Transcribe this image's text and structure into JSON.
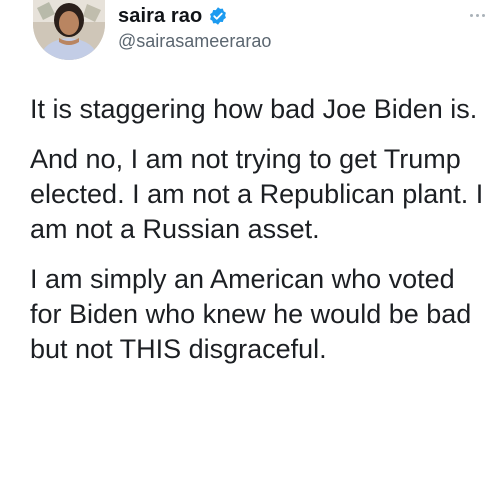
{
  "author": {
    "display_name": "saira rao",
    "handle": "@sairasameerarao",
    "verified": true,
    "verified_color": "#1d9bf0"
  },
  "tweet": {
    "paragraphs": [
      "It is staggering how bad Joe Biden is.",
      "And no, I am not trying to get Trump elected. I am not a Republican plant. I am not a Russian asset.",
      "I am simply an American who voted for Biden who knew he would be bad but not THIS disgraceful."
    ]
  },
  "icons": {
    "verified": "verified-badge-icon",
    "more": "more-options-icon"
  }
}
